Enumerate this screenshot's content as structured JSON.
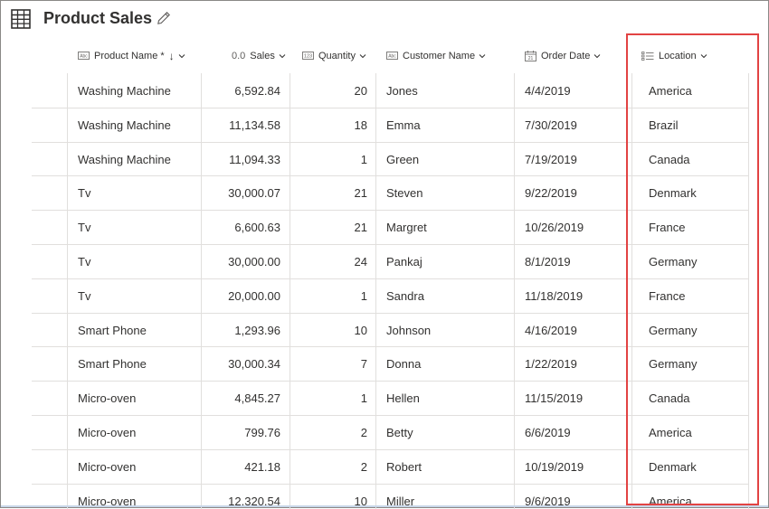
{
  "title": "Product Sales",
  "columns": [
    {
      "key": "product",
      "label": "Product Name",
      "required": "*",
      "sort": "↓",
      "icon": "text-type-icon"
    },
    {
      "key": "sales",
      "label": "Sales",
      "icon": "decimal-type-icon",
      "icon_text": "0.0"
    },
    {
      "key": "quantity",
      "label": "Quantity",
      "icon": "number-type-icon"
    },
    {
      "key": "customer",
      "label": "Customer Name",
      "icon": "text-type-icon"
    },
    {
      "key": "date",
      "label": "Order Date",
      "icon": "calendar-icon"
    },
    {
      "key": "location",
      "label": "Location",
      "icon": "choice-list-icon"
    }
  ],
  "rows": [
    {
      "product": "Washing Machine",
      "sales": "6,592.84",
      "quantity": "20",
      "customer": "Jones",
      "date": "4/4/2019",
      "location": "America"
    },
    {
      "product": "Washing Machine",
      "sales": "11,134.58",
      "quantity": "18",
      "customer": "Emma",
      "date": "7/30/2019",
      "location": "Brazil"
    },
    {
      "product": "Washing Machine",
      "sales": "11,094.33",
      "quantity": "1",
      "customer": "Green",
      "date": "7/19/2019",
      "location": "Canada"
    },
    {
      "product": "Tv",
      "sales": "30,000.07",
      "quantity": "21",
      "customer": "Steven",
      "date": "9/22/2019",
      "location": "Denmark"
    },
    {
      "product": "Tv",
      "sales": "6,600.63",
      "quantity": "21",
      "customer": "Margret",
      "date": "10/26/2019",
      "location": "France"
    },
    {
      "product": "Tv",
      "sales": "30,000.00",
      "quantity": "24",
      "customer": "Pankaj",
      "date": "8/1/2019",
      "location": "Germany"
    },
    {
      "product": "Tv",
      "sales": "20,000.00",
      "quantity": "1",
      "customer": "Sandra",
      "date": "11/18/2019",
      "location": "France"
    },
    {
      "product": "Smart Phone",
      "sales": "1,293.96",
      "quantity": "10",
      "customer": "Johnson",
      "date": "4/16/2019",
      "location": "Germany"
    },
    {
      "product": "Smart Phone",
      "sales": "30,000.34",
      "quantity": "7",
      "customer": "Donna",
      "date": "1/22/2019",
      "location": "Germany"
    },
    {
      "product": "Micro-oven",
      "sales": "4,845.27",
      "quantity": "1",
      "customer": "Hellen",
      "date": "11/15/2019",
      "location": "Canada"
    },
    {
      "product": "Micro-oven",
      "sales": "799.76",
      "quantity": "2",
      "customer": "Betty",
      "date": "6/6/2019",
      "location": "America"
    },
    {
      "product": "Micro-oven",
      "sales": "421.18",
      "quantity": "2",
      "customer": "Robert",
      "date": "10/19/2019",
      "location": "Denmark"
    },
    {
      "product": "Micro-oven",
      "sales": "12,320.54",
      "quantity": "10",
      "customer": "Miller",
      "date": "9/6/2019",
      "location": "America"
    }
  ],
  "highlight_color": "#e24343"
}
